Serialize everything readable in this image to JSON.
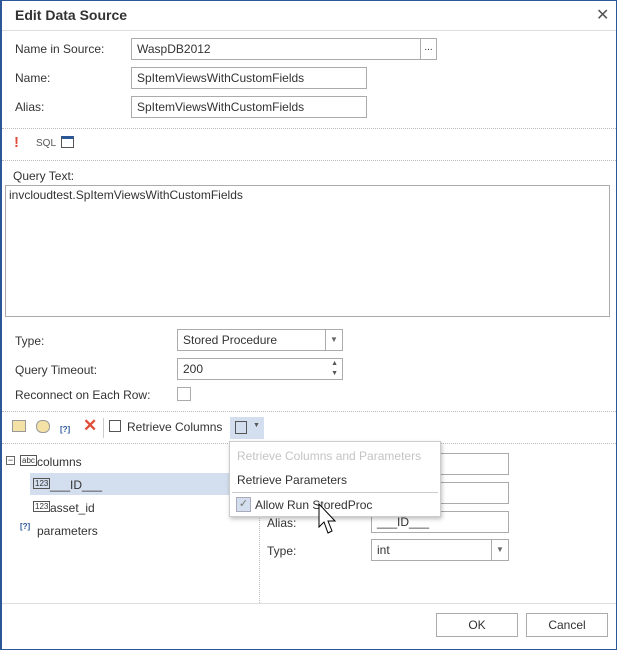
{
  "dialog": {
    "title": "Edit Data Source",
    "close_icon": "close-icon"
  },
  "fields": {
    "name_in_source_label": "Name in Source:",
    "name_in_source": "WaspDB2012",
    "browse_label": "...",
    "name_label": "Name:",
    "name": "SpItemViewsWithCustomFields",
    "alias_label": "Alias:",
    "alias": "SpItemViewsWithCustomFields"
  },
  "query_toolbar": {
    "sql_label": "SQL"
  },
  "query": {
    "label": "Query Text:",
    "text": "invcloudtest.SpItemViewsWithCustomFields"
  },
  "options": {
    "type_label": "Type:",
    "type": "Stored Procedure",
    "timeout_label": "Query Timeout:",
    "timeout": "200",
    "reconnect_label": "Reconnect on Each Row:",
    "reconnect": false
  },
  "columns_toolbar": {
    "retrieve_columns": "Retrieve Columns"
  },
  "tree": {
    "columns": "columns",
    "items": [
      "___ID___",
      "asset_id"
    ],
    "parameters": "parameters",
    "type_badge": "123",
    "abc_badge": "abc"
  },
  "details": {
    "alias_label": "Alias:",
    "alias": "___ID___",
    "type_label": "Type:",
    "type": "int"
  },
  "menu": {
    "items": [
      {
        "label": "Retrieve Columns and Parameters",
        "disabled": true
      },
      {
        "label": "Retrieve Parameters",
        "disabled": false
      },
      {
        "label": "Allow Run StoredProc",
        "checked": true
      }
    ]
  },
  "footer": {
    "ok": "OK",
    "cancel": "Cancel"
  },
  "colors": {
    "accent": "#2b5797",
    "selection": "#d3deef",
    "error": "#e04e39"
  }
}
